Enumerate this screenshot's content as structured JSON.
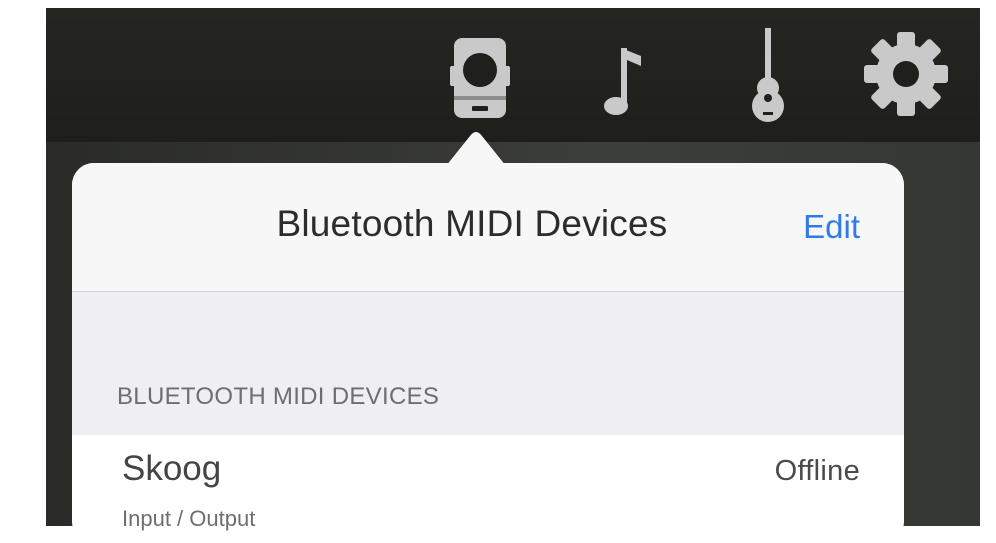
{
  "toolbar": {
    "icons": [
      "midi-device-icon",
      "music-note-icon",
      "guitar-icon",
      "gear-icon"
    ]
  },
  "popover": {
    "title": "Bluetooth MIDI Devices",
    "edit_label": "Edit",
    "section_header": "BLUETOOTH MIDI DEVICES",
    "devices": [
      {
        "name": "Skoog",
        "status": "Offline",
        "mode": "Input / Output"
      }
    ]
  },
  "colors": {
    "toolbar": "#1f201c",
    "accent": "#2f7ce8",
    "icon": "#c9c9c9"
  }
}
